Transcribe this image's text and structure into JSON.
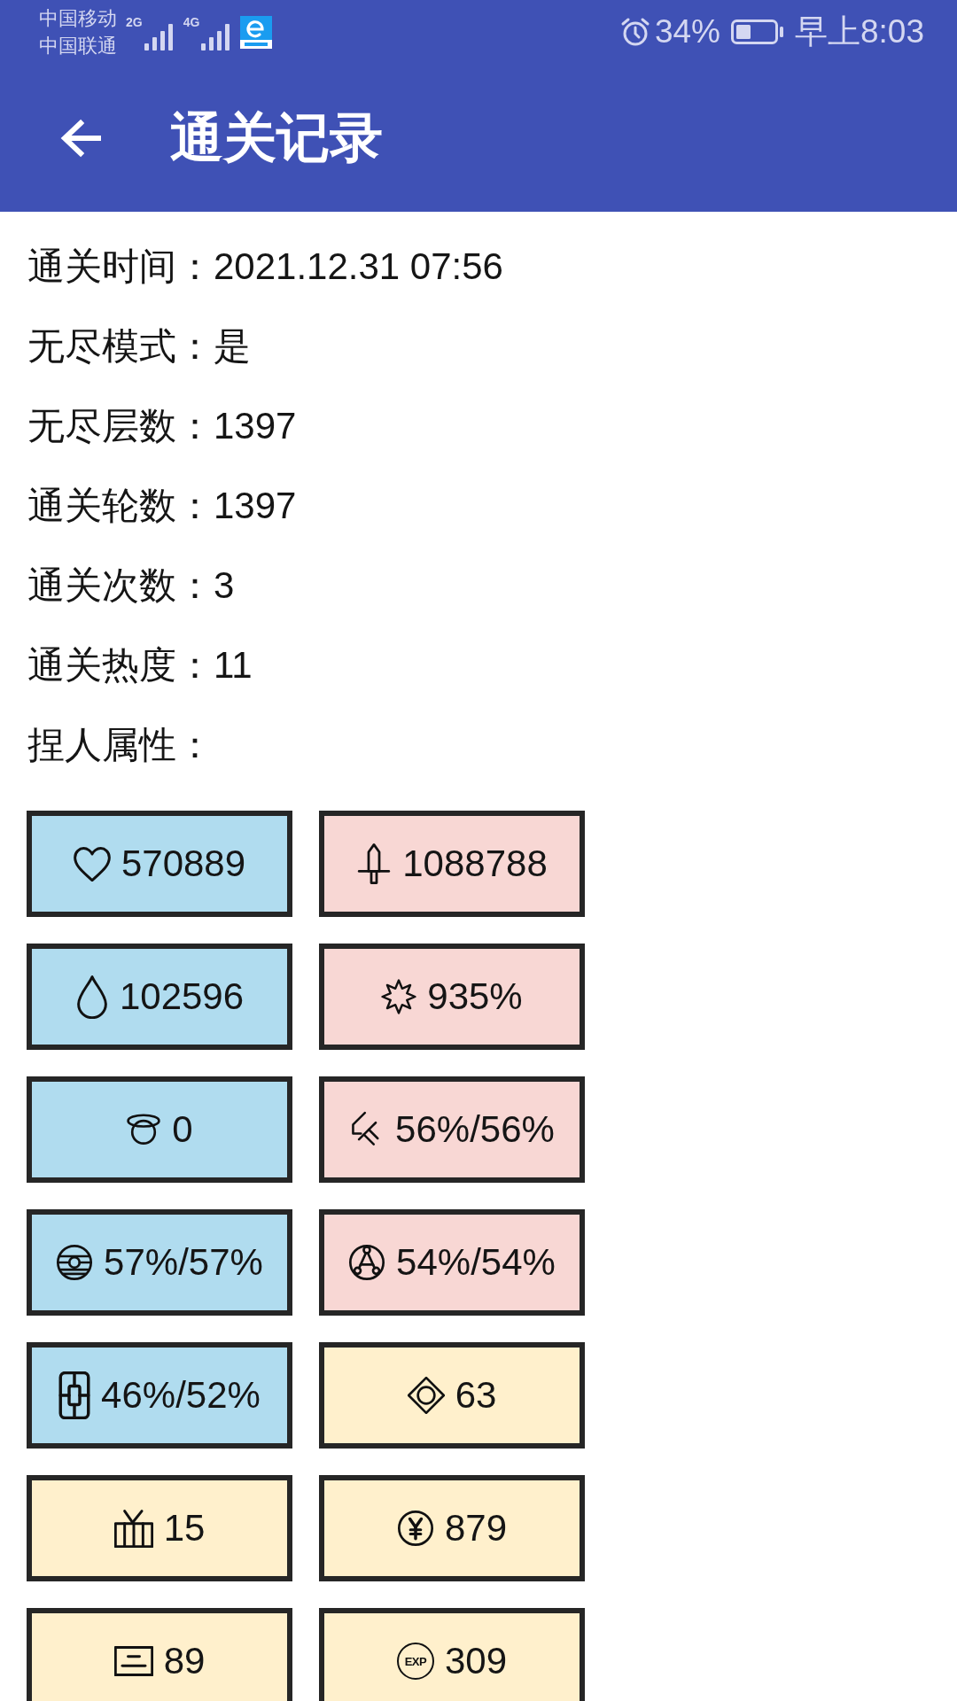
{
  "status_bar": {
    "carriers": [
      "中国移动",
      "中国联通"
    ],
    "networks": [
      "2G",
      "4G"
    ],
    "battery_percent": "34%",
    "time": "早上8:03"
  },
  "app_bar": {
    "title": "通关记录"
  },
  "records": [
    {
      "label": "通关时间：",
      "value": "2021.12.31 07:56"
    },
    {
      "label": "无尽模式：",
      "value": "是"
    },
    {
      "label": "无尽层数：",
      "value": "1397"
    },
    {
      "label": "通关轮数：",
      "value": "1397"
    },
    {
      "label": "通关次数：",
      "value": "3"
    },
    {
      "label": "通关热度：",
      "value": "11"
    }
  ],
  "attributes_title": "捏人属性：",
  "attributes": [
    {
      "kind": "heart",
      "value": "570889",
      "color": "#b0dcef"
    },
    {
      "kind": "sword",
      "value": "1088788",
      "color": "#f8d7d4"
    },
    {
      "kind": "drop",
      "value": "102596",
      "color": "#b0dcef"
    },
    {
      "kind": "burst",
      "value": "935%",
      "color": "#f8d7d4"
    },
    {
      "kind": "halo",
      "value": "0",
      "color": "#b0dcef"
    },
    {
      "kind": "brush",
      "value": "56%/56%",
      "color": "#f8d7d4"
    },
    {
      "kind": "disc",
      "value": "57%/57%",
      "color": "#b0dcef"
    },
    {
      "kind": "nodes",
      "value": "54%/54%",
      "color": "#f8d7d4"
    },
    {
      "kind": "panel",
      "value": "46%/52%",
      "color": "#b0dcef"
    },
    {
      "kind": "diamond",
      "value": "63",
      "color": "#fff0cc"
    },
    {
      "kind": "tv",
      "value": "15",
      "color": "#fff0cc"
    },
    {
      "kind": "coin",
      "value": "879",
      "color": "#fff0cc"
    },
    {
      "kind": "card",
      "value": "89",
      "color": "#fff0cc"
    },
    {
      "kind": "exp",
      "icon_text": "EXP",
      "value": "309",
      "color": "#fff0cc"
    }
  ]
}
